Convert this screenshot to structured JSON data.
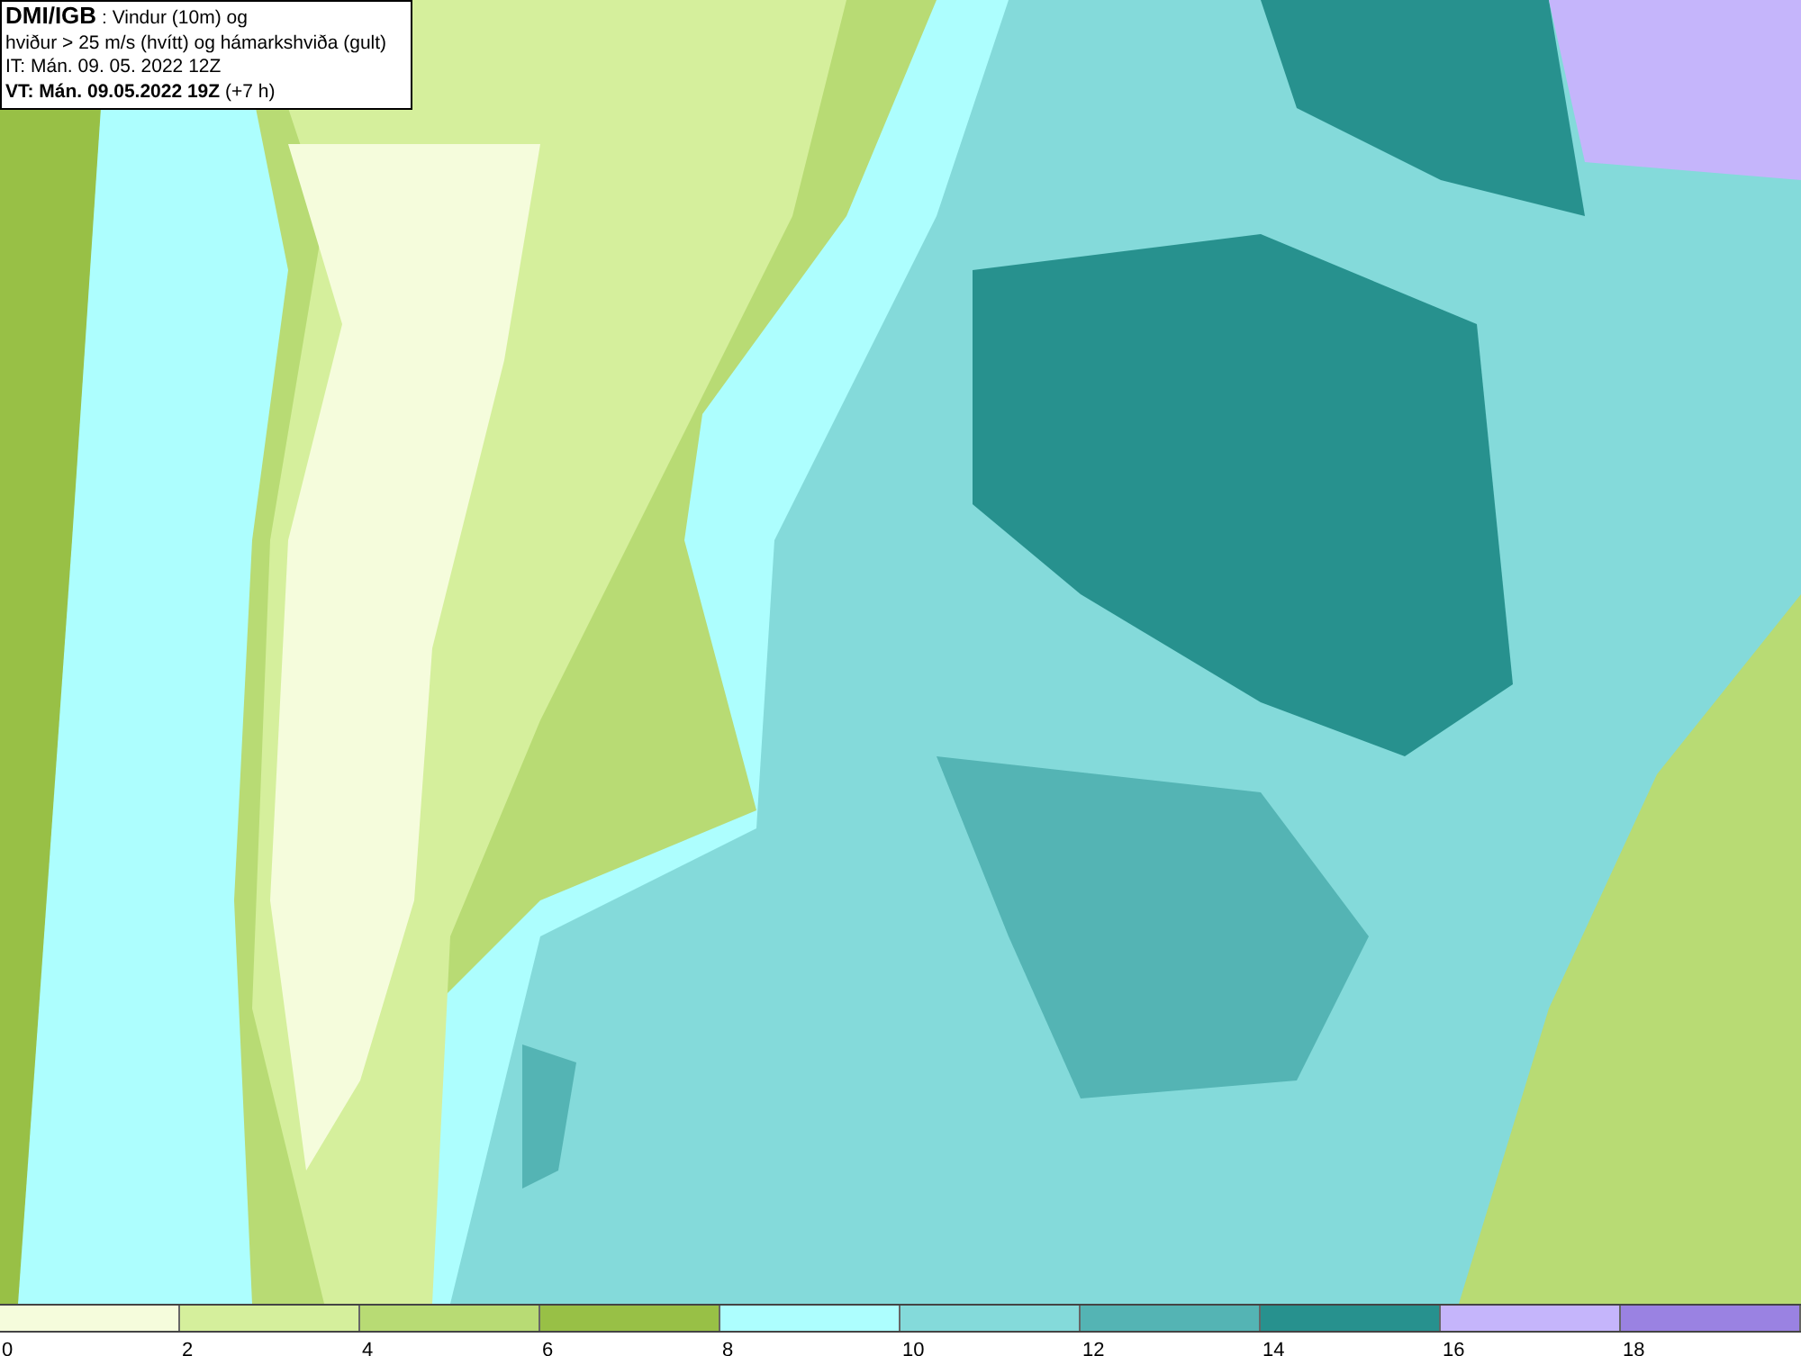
{
  "title_box": {
    "lines": [
      "**DMI/IGB** : Vindur (10m) og",
      "hviður > 25 m/s (hvítt) og hámarkshviða (gult)",
      "IT: Mán. 09. 05. 2022 12Z",
      "**VT: Mán. 09.05.2022 19Z** (+7 h)"
    ]
  },
  "legend": [
    {
      "label": "0",
      "color": "#f5fcdc"
    },
    {
      "label": "2",
      "color": "#d5ef9c"
    },
    {
      "label": "4",
      "color": "#b8db74"
    },
    {
      "label": "6",
      "color": "#98c046"
    },
    {
      "label": "8",
      "color": "#adfefe"
    },
    {
      "label": "10",
      "color": "#84dada"
    },
    {
      "label": "12",
      "color": "#54b4b4"
    },
    {
      "label": "14",
      "color": "#27918e"
    },
    {
      "label": "16",
      "color": "#c5b5fb"
    },
    {
      "label": "18",
      "color": "#9a82e2"
    }
  ]
}
